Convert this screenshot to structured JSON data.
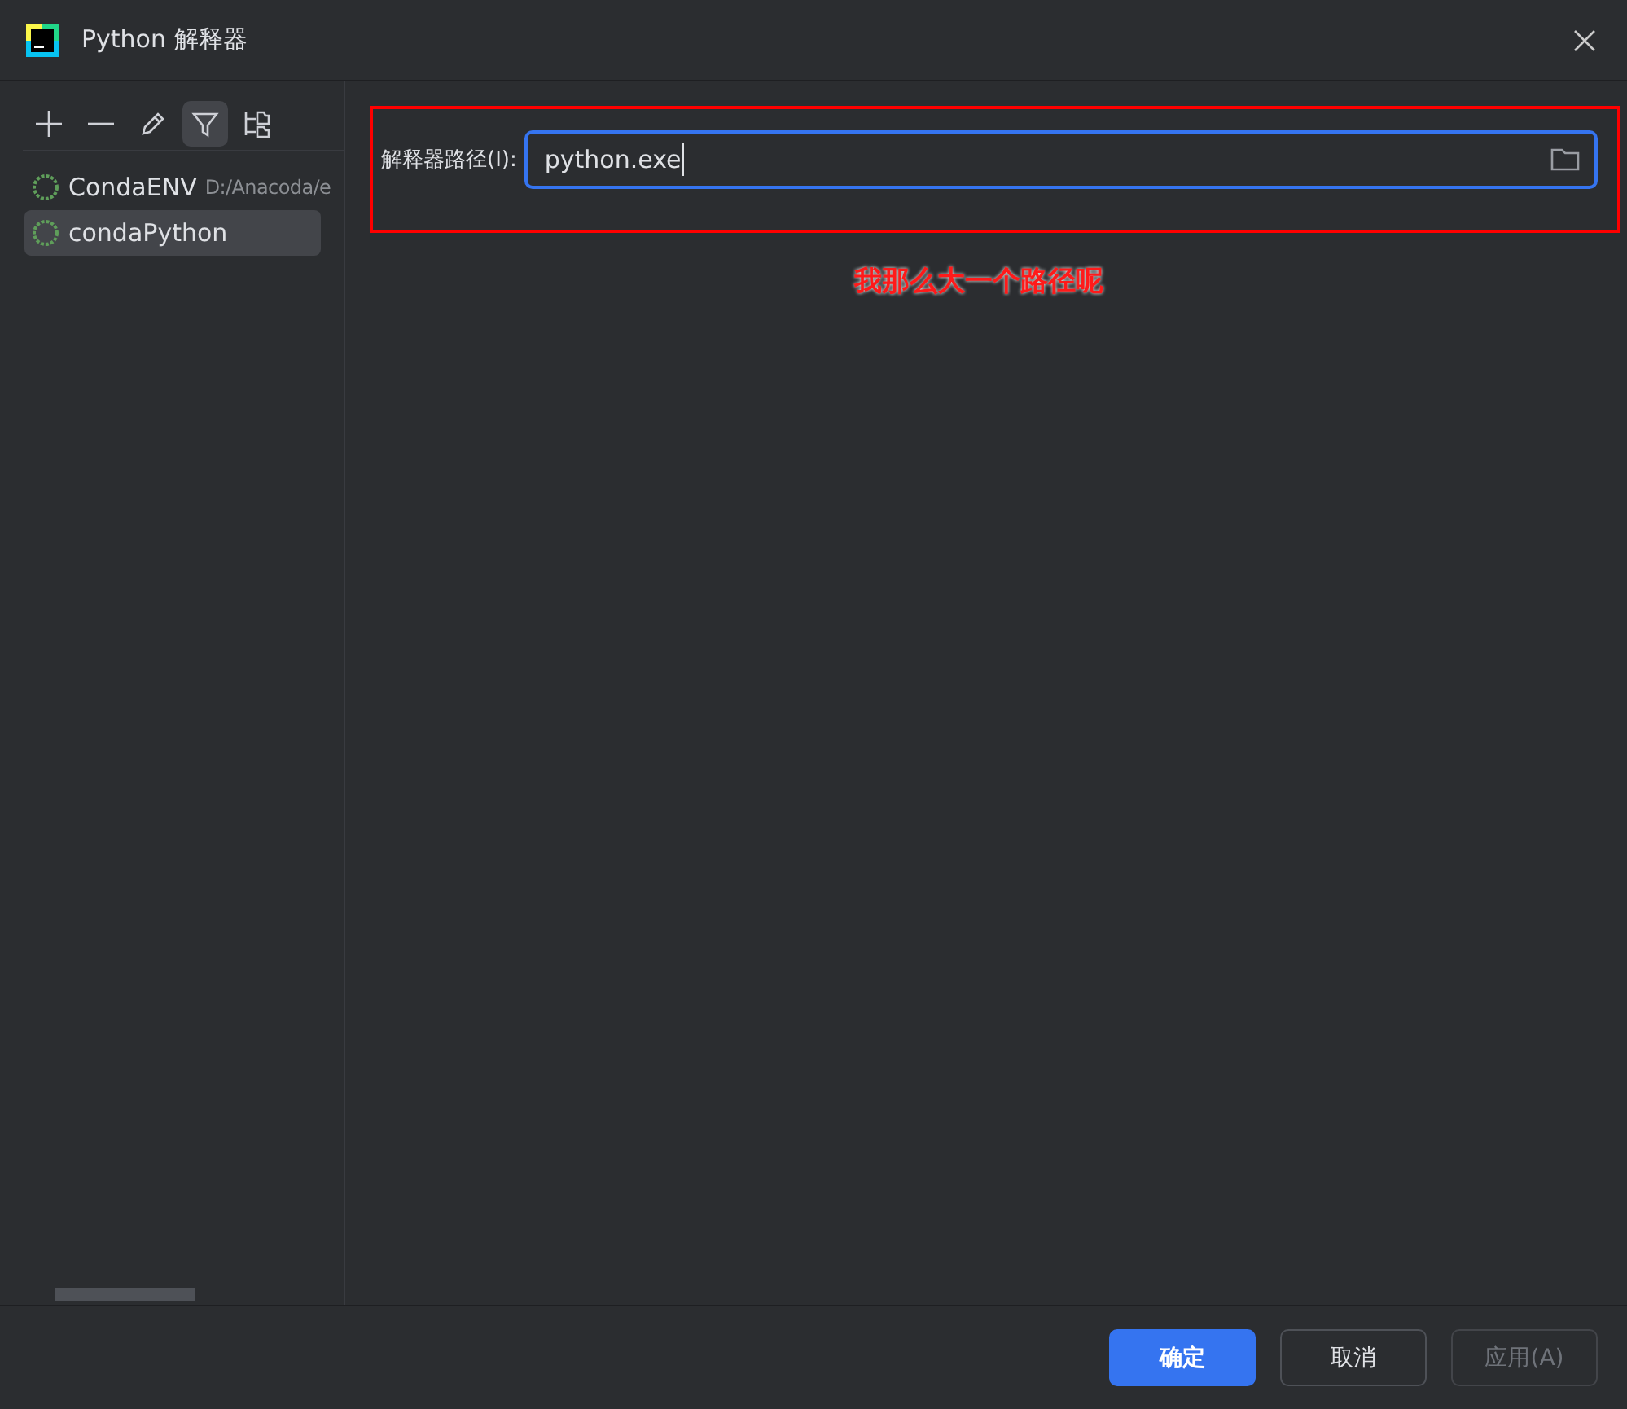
{
  "window": {
    "title": "Python 解释器"
  },
  "toolbar": [
    {
      "kind": "add",
      "selected": false
    },
    {
      "kind": "remove",
      "selected": false
    },
    {
      "kind": "edit",
      "selected": false
    },
    {
      "kind": "filter",
      "selected": true
    },
    {
      "kind": "tree",
      "selected": false
    }
  ],
  "interpreters": [
    {
      "name": "CondaENV",
      "path": "D:/Anacoda/e",
      "selected": false
    },
    {
      "name": "condaPython",
      "selected": true
    }
  ],
  "path_field": {
    "label": "解释器路径(I):",
    "value": "python.exe"
  },
  "annotation": {
    "text": "我那么大一个路径呢"
  },
  "buttons": [
    {
      "label": "确定",
      "kind": "primary",
      "disabled": false
    },
    {
      "label": "取消",
      "kind": "normal",
      "disabled": false
    },
    {
      "label": "应用(A)",
      "kind": "normal",
      "disabled": true
    }
  ]
}
